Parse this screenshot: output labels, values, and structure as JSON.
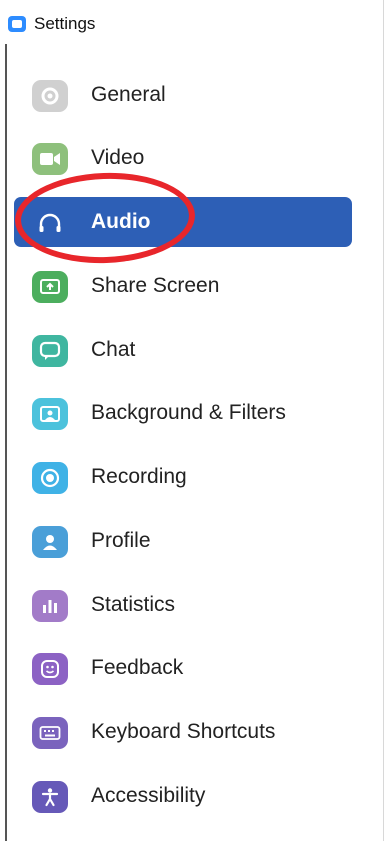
{
  "window": {
    "title": "Settings",
    "app_icon": "zoom-app-icon"
  },
  "sidebar": {
    "selected": "Audio",
    "accent_color": "#2d5fb6",
    "items": [
      {
        "label": "General",
        "icon": "gear-icon",
        "color": "#d0d0d0"
      },
      {
        "label": "Video",
        "icon": "video-camera-icon",
        "color": "#8ec07c"
      },
      {
        "label": "Audio",
        "icon": "headphones-icon",
        "color": "#ffffff"
      },
      {
        "label": "Share Screen",
        "icon": "share-screen-icon",
        "color": "#4cae5e"
      },
      {
        "label": "Chat",
        "icon": "chat-bubble-icon",
        "color": "#3fb6a0"
      },
      {
        "label": "Background & Filters",
        "icon": "person-background-icon",
        "color": "#4cc2dc"
      },
      {
        "label": "Recording",
        "icon": "record-icon",
        "color": "#3fb2e6"
      },
      {
        "label": "Profile",
        "icon": "profile-icon",
        "color": "#4a9fd8"
      },
      {
        "label": "Statistics",
        "icon": "bar-chart-icon",
        "color": "#a27bc8"
      },
      {
        "label": "Feedback",
        "icon": "smiley-icon",
        "color": "#8c62c4"
      },
      {
        "label": "Keyboard Shortcuts",
        "icon": "keyboard-icon",
        "color": "#7a63bd"
      },
      {
        "label": "Accessibility",
        "icon": "accessibility-icon",
        "color": "#6659b8"
      }
    ]
  },
  "annotation": {
    "type": "red-ellipse-highlight",
    "target": "Audio",
    "color": "#e8262b"
  }
}
